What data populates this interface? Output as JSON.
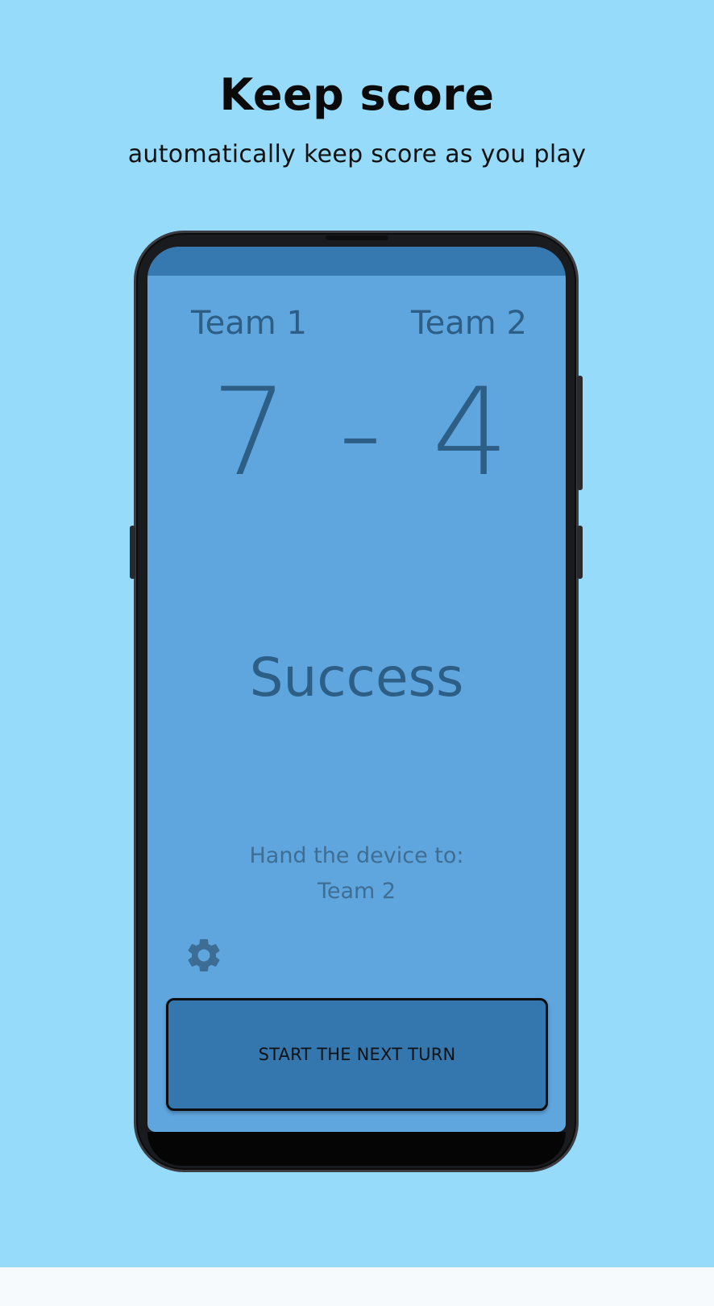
{
  "header": {
    "title": "Keep score",
    "subtitle": "automatically keep score as you play"
  },
  "game": {
    "team1_name": "Team 1",
    "team2_name": "Team 2",
    "team1_score": "7",
    "separator": "-",
    "team2_score": "4",
    "result": "Success",
    "hand_label": "Hand the device to:",
    "hand_team": "Team 2",
    "next_button_label": "START THE NEXT TURN",
    "settings_icon": "gear-icon"
  },
  "colors": {
    "background": "#97dbfa",
    "screen": "#5fa5de",
    "status_bar": "#3579b0",
    "button": "#3477ae",
    "text_dark_blue": "#2d5e86"
  }
}
